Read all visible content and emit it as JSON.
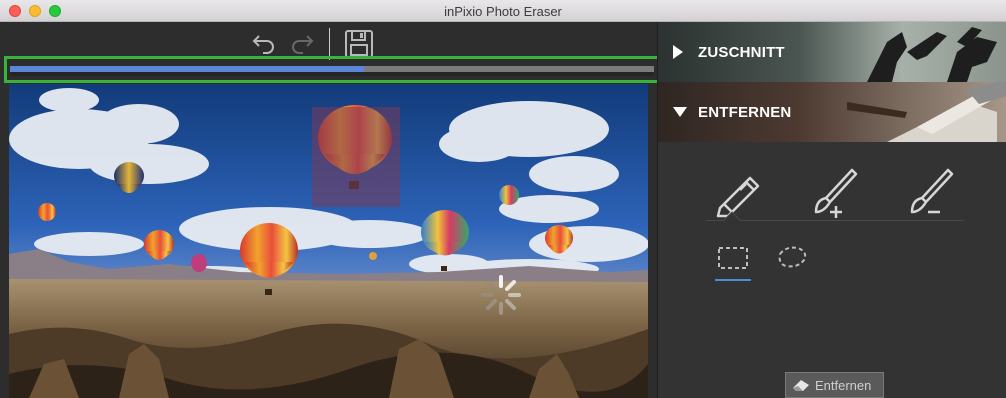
{
  "window": {
    "title": "inPixio Photo Eraser"
  },
  "toolbar": {
    "undo_icon": "undo-arrow-icon",
    "redo_icon": "redo-arrow-icon",
    "save_icon": "floppy-disk-icon"
  },
  "progress": {
    "value": 0.55
  },
  "photo": {
    "description_icon": "hot-air-balloons-photo"
  },
  "panel": {
    "section1": {
      "label": "ZUSCHNITT",
      "expanded": false
    },
    "section2": {
      "label": "ENTFERNEN",
      "expanded": true
    },
    "tools": [
      "marker-tool-icon",
      "brush-plus-icon",
      "brush-minus-icon"
    ],
    "selection_tools": [
      "rectangle-select-icon",
      "lasso-select-icon"
    ],
    "remove_button": "Entfernen"
  },
  "colors": {
    "progress_fill": "#5c86d8",
    "highlight_box": "#36b43c",
    "accent_underline": "#4b8ed6"
  }
}
